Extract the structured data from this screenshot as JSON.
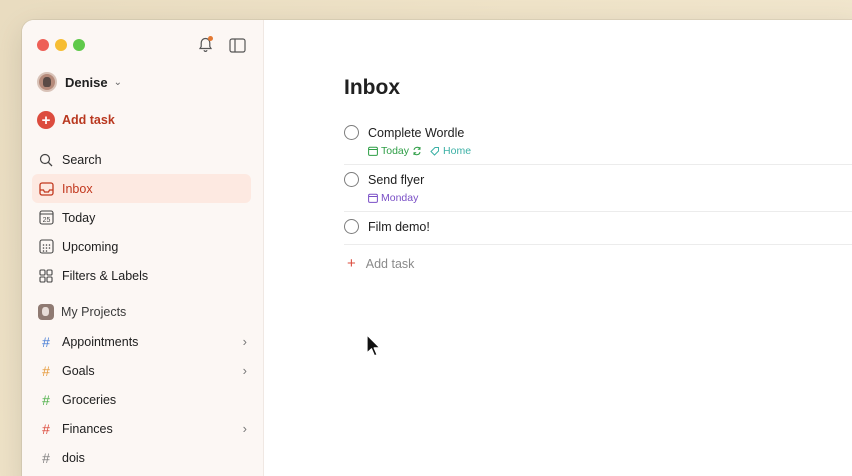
{
  "user": {
    "name": "Denise"
  },
  "sidebar": {
    "add_task_label": "Add task",
    "nav": [
      {
        "label": "Search",
        "icon": "search-icon"
      },
      {
        "label": "Inbox",
        "icon": "inbox-icon",
        "active": true
      },
      {
        "label": "Today",
        "icon": "calendar-today-icon",
        "day": "25"
      },
      {
        "label": "Upcoming",
        "icon": "calendar-grid-icon"
      },
      {
        "label": "Filters & Labels",
        "icon": "grid-icon"
      }
    ],
    "projects_header": "My Projects",
    "projects": [
      {
        "label": "Appointments",
        "hash_color": "#4a7fd6",
        "has_children": true
      },
      {
        "label": "Goals",
        "hash_color": "#e59a3c",
        "has_children": true
      },
      {
        "label": "Groceries",
        "hash_color": "#4fb04a",
        "has_children": false
      },
      {
        "label": "Finances",
        "hash_color": "#dc4c3e",
        "has_children": true
      },
      {
        "label": "dois",
        "hash_color": "#808080",
        "has_children": false
      }
    ]
  },
  "main": {
    "title": "Inbox",
    "tasks": [
      {
        "title": "Complete Wordle",
        "meta": [
          {
            "text": "Today",
            "color": "#2e9e46",
            "icon": "calendar-icon",
            "recurring": true
          },
          {
            "text": "Home",
            "color": "#3bb0a5",
            "icon": "tag-icon"
          }
        ]
      },
      {
        "title": "Send flyer",
        "meta": [
          {
            "text": "Monday",
            "color": "#7a4fc6",
            "icon": "calendar-icon"
          }
        ]
      },
      {
        "title": "Film demo!",
        "meta": []
      }
    ],
    "add_task_label": "Add task"
  },
  "colors": {
    "accent": "#dc4c3e",
    "sidebar_bg": "#fcf7f4",
    "active_bg": "#fde9e1"
  }
}
